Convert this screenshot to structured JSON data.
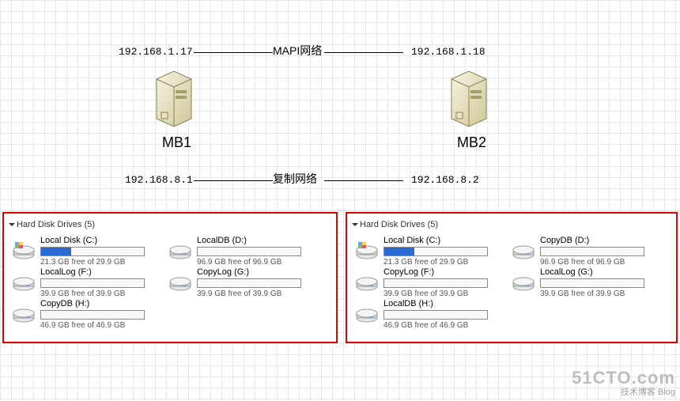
{
  "top_network": {
    "left_ip": "192.168.1.17",
    "right_ip": "192.168.1.18",
    "label": "MAPI网络"
  },
  "bottom_network": {
    "left_ip": "192.168.8.1",
    "right_ip": "192.168.8.2",
    "label": "复制网络"
  },
  "servers": {
    "left": "MB1",
    "right": "MB2"
  },
  "panels": {
    "left": {
      "header": "Hard Disk Drives (5)",
      "drives": [
        {
          "name": "Local Disk (C:)",
          "free": "21.3 GB free of 29.9 GB",
          "fill": 29,
          "os": true
        },
        {
          "name": "LocalDB (D:)",
          "free": "96.9 GB free of 96.9 GB",
          "fill": 0
        },
        {
          "name": "LocalLog (F:)",
          "free": "39.9 GB free of 39.9 GB",
          "fill": 0
        },
        {
          "name": "CopyLog (G:)",
          "free": "39.9 GB free of 39.9 GB",
          "fill": 0
        },
        {
          "name": "CopyDB (H:)",
          "free": "46.9 GB free of 46.9 GB",
          "fill": 0
        }
      ]
    },
    "right": {
      "header": "Hard Disk Drives (5)",
      "drives": [
        {
          "name": "Local Disk (C:)",
          "free": "21.3 GB free of 29.9 GB",
          "fill": 29,
          "os": true
        },
        {
          "name": "CopyDB (D:)",
          "free": "96.9 GB free of 96.9 GB",
          "fill": 0
        },
        {
          "name": "CopyLog (F:)",
          "free": "39.9 GB free of 39.9 GB",
          "fill": 0
        },
        {
          "name": "LocalLog (G:)",
          "free": "39.9 GB free of 39.9 GB",
          "fill": 0
        },
        {
          "name": "LocalDB (H:)",
          "free": "46.9 GB free of 46.9 GB",
          "fill": 0
        }
      ]
    }
  },
  "watermark": {
    "big": "51CTO.com",
    "small": "技术博客    Blog"
  }
}
